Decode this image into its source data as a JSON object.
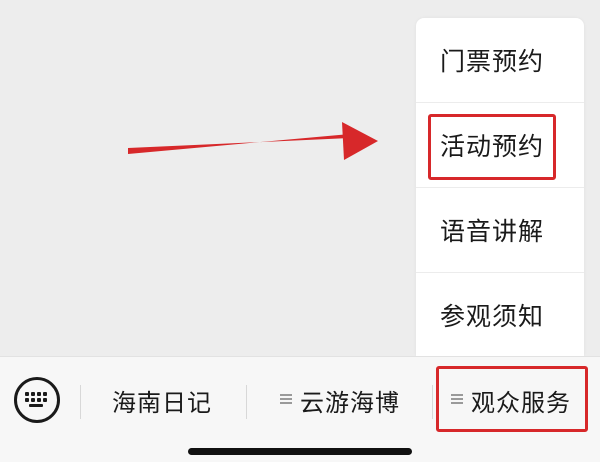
{
  "popup_menu": {
    "items": [
      {
        "label": "门票预约"
      },
      {
        "label": "活动预约"
      },
      {
        "label": "语音讲解"
      },
      {
        "label": "参观须知"
      }
    ],
    "highlighted_item": "活动预约"
  },
  "bottom_bar": {
    "keyboard_icon": "keyboard-icon",
    "tabs": [
      {
        "label": "海南日记",
        "has_menu_icon": false
      },
      {
        "label": "云游海博",
        "has_menu_icon": true
      },
      {
        "label": "观众服务",
        "has_menu_icon": true
      }
    ]
  },
  "annotation": {
    "arrow_color": "#d7282a",
    "highlight_color": "#d7282a"
  }
}
